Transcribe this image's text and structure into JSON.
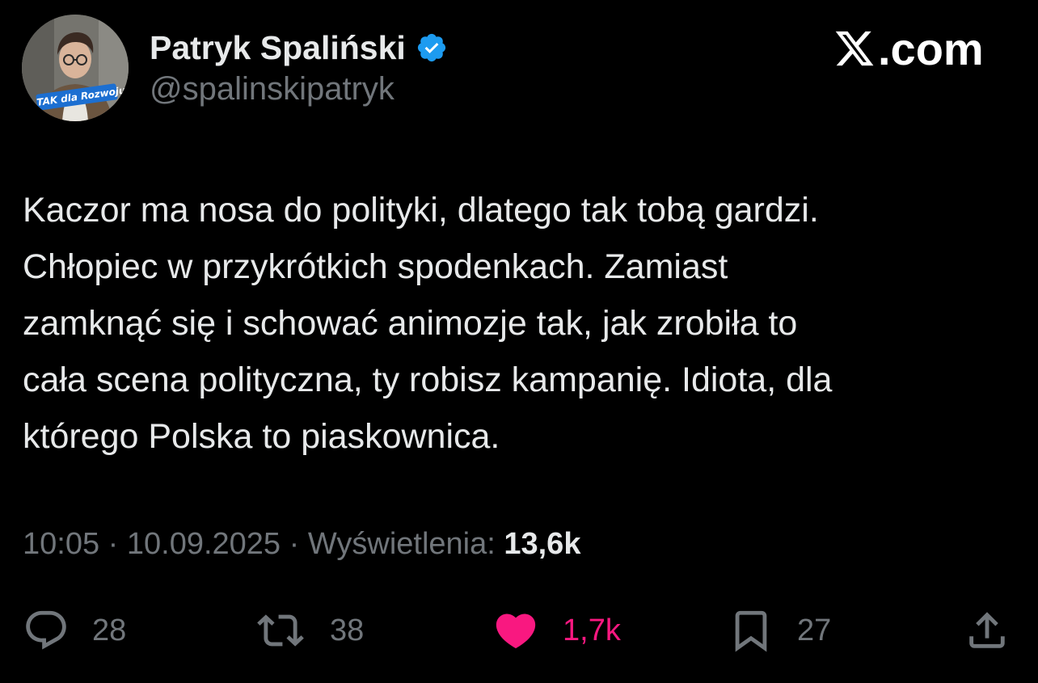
{
  "author": {
    "display_name": "Patryk Spaliński",
    "handle": "@spalinskipatryk",
    "verified": true,
    "verified_color": "#1d9bf0",
    "avatar_badge_text": "TAK dla Rozwoju"
  },
  "brand": {
    "label": ".com",
    "logo_icon": "x-logo-icon"
  },
  "tweet": {
    "lines": [
      "Kaczor ma nosa do polityki, dlatego tak tobą gardzi.",
      "Chłopiec w przykrótkich spodenkach. Zamiast",
      "zamknąć się i schować animozje tak, jak zrobiła to",
      "cała scena polityczna, ty robisz kampanię. Idiota, dla",
      "którego Polska to piaskownica."
    ]
  },
  "meta": {
    "time": "10:05",
    "date": "10.09.2025",
    "views_label": "Wyświetlenia:",
    "views_count": "13,6k",
    "separator": " · "
  },
  "actions": {
    "reply": {
      "icon": "reply-bubble-icon",
      "count": "28"
    },
    "retweet": {
      "icon": "retweet-icon",
      "count": "38"
    },
    "like": {
      "icon": "heart-icon",
      "count": "1,7k",
      "active": true,
      "color": "#f91880"
    },
    "bookmark": {
      "icon": "bookmark-icon",
      "count": "27"
    },
    "share": {
      "icon": "share-icon"
    }
  },
  "colors": {
    "background": "#000000",
    "text_primary": "#e7e9ea",
    "text_secondary": "#71767b",
    "like_active": "#f91880"
  }
}
